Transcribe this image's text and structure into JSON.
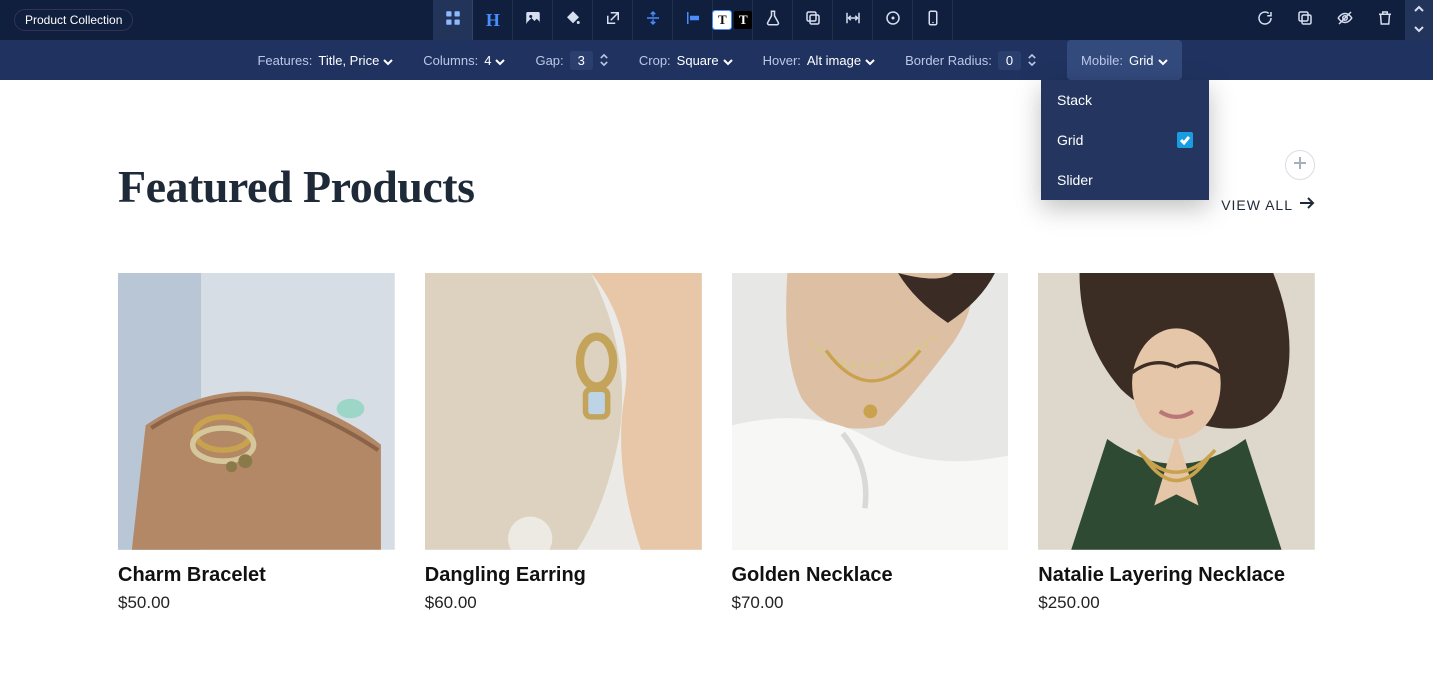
{
  "block_label": "Product Collection",
  "options": {
    "features": {
      "label": "Features:",
      "value": "Title, Price"
    },
    "columns": {
      "label": "Columns:",
      "value": "4"
    },
    "gap": {
      "label": "Gap:",
      "value": "3"
    },
    "crop": {
      "label": "Crop:",
      "value": "Square"
    },
    "hover": {
      "label": "Hover:",
      "value": "Alt image"
    },
    "radius": {
      "label": "Border Radius:",
      "value": "0"
    },
    "mobile": {
      "label": "Mobile:",
      "value": "Grid"
    }
  },
  "mobile_dropdown": {
    "items": [
      {
        "label": "Stack",
        "checked": false
      },
      {
        "label": "Grid",
        "checked": true
      },
      {
        "label": "Slider",
        "checked": false
      }
    ]
  },
  "section": {
    "title": "Featured Products",
    "view_all": "VIEW ALL"
  },
  "products": [
    {
      "title": "Charm Bracelet",
      "price": "$50.00"
    },
    {
      "title": "Dangling Earring",
      "price": "$60.00"
    },
    {
      "title": "Golden Necklace",
      "price": "$70.00"
    },
    {
      "title": "Natalie Layering Necklace",
      "price": "$250.00"
    }
  ],
  "icons": {
    "grid": "grid-icon",
    "heading": "heading-icon",
    "image": "image-icon",
    "paint": "paint-icon",
    "openext": "open-external-icon",
    "alignv": "align-vertical-icon",
    "alignl": "align-left-icon",
    "textblock": "text-block-icon",
    "flask": "flask-icon",
    "copy": "copy-icon",
    "width": "width-icon",
    "target": "target-icon",
    "phone": "phone-icon",
    "refresh": "refresh-icon",
    "duplicate": "duplicate-icon",
    "hide": "hide-icon",
    "trash": "trash-icon",
    "up": "up-arrow-icon",
    "down": "down-arrow-icon",
    "plus": "plus-icon",
    "arrowr": "arrow-right-icon",
    "chev": "chevron-down-icon",
    "check": "check-icon"
  }
}
